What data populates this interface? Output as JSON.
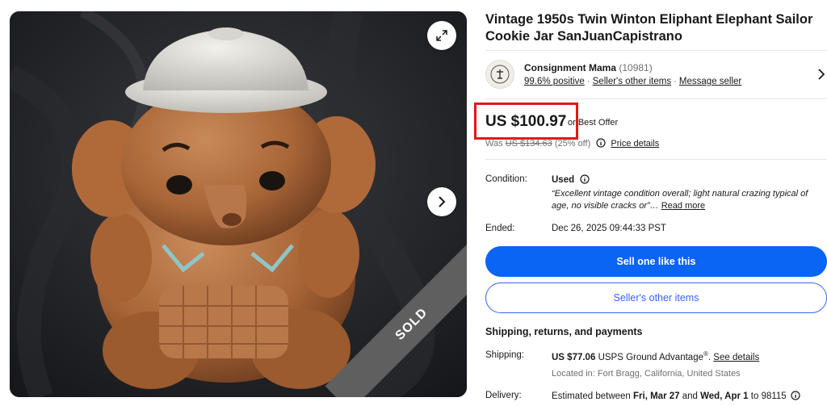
{
  "listing": {
    "title": "Vintage 1950s Twin Winton Eliphant Elephant Sailor Cookie Jar SanJuanCapistrano",
    "sold_label": "SOLD"
  },
  "seller": {
    "name": "Consignment Mama",
    "feedback_count": "(10981)",
    "positive": "99.6% positive",
    "other_items": "Seller's other items",
    "message": "Message seller"
  },
  "price": {
    "current": "US $100.97",
    "offer": "or Best Offer",
    "was_prefix": "Was",
    "was_amount": "US $134.63",
    "discount": "(25% off)",
    "details_link": "Price details"
  },
  "condition": {
    "label": "Condition:",
    "value": "Used",
    "quote": "“Excellent vintage condition overall; light natural crazing typical of age, no visible cracks or”…",
    "read_more": "Read more"
  },
  "ended": {
    "label": "Ended:",
    "value": "Dec 26, 2025 09:44:33 PST"
  },
  "buttons": {
    "sell_one": "Sell one like this",
    "other_items": "Seller's other items"
  },
  "shipping": {
    "section_title": "Shipping, returns, and payments",
    "label": "Shipping:",
    "amount": "US $77.06",
    "service": "USPS Ground Advantage",
    "registered": "®",
    "punct": ".",
    "see_details": "See details",
    "location": "Located in: Fort Bragg, California, United States"
  },
  "delivery": {
    "label": "Delivery:",
    "prefix": "Estimated between",
    "start": "Fri, Mar 27",
    "and": "and",
    "end": "Wed, Apr 1",
    "to": "to 98115"
  },
  "colors": {
    "primary_blue": "#0a64f4",
    "link_blue": "#3665f3",
    "highlight_red": "#e0181c",
    "ribbon_gray": "#5f5f5f"
  },
  "icons": [
    "expand-icon",
    "chevron-right-icon",
    "info-icon",
    "seller-logo"
  ]
}
